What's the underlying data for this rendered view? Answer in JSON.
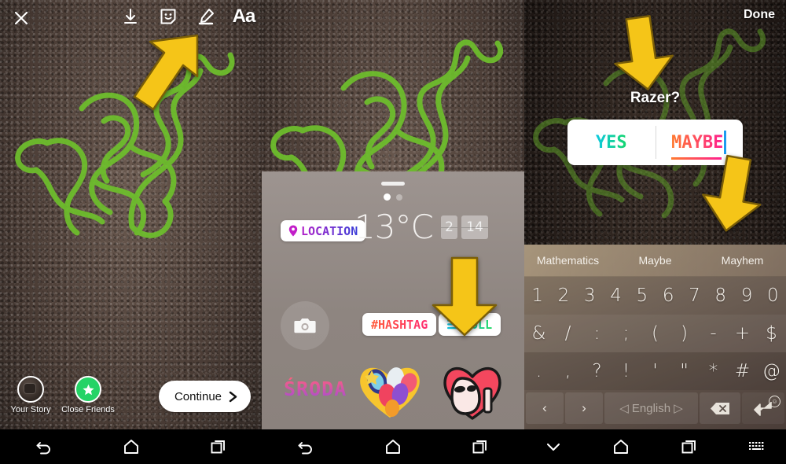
{
  "panel1": {
    "name": "instagram-story-editor",
    "toolbar": {
      "close_icon": "close-icon",
      "save_icon": "download-icon",
      "sticker_icon": "sticker-smiley-icon",
      "draw_icon": "marker-pen-icon",
      "text_label": "Aa"
    },
    "audience": [
      {
        "label": "Your Story",
        "icon": "avatar"
      },
      {
        "label": "Close Friends",
        "icon": "green-star-icon"
      }
    ],
    "continue_label": "Continue",
    "continue_chevron": "chevron-right-icon",
    "annotation": "arrow-pointing-to-sticker-icon",
    "nav": [
      "back-icon",
      "home-icon",
      "recents-icon"
    ]
  },
  "panel2": {
    "name": "sticker-tray",
    "handle": "drag-handle",
    "page_dots": {
      "count": 2,
      "active": 0
    },
    "stickers": [
      {
        "id": "location",
        "label": "LOCATION",
        "icon": "map-pin-icon"
      },
      {
        "id": "temperature",
        "label": "13°C"
      },
      {
        "id": "time",
        "digits": [
          "2",
          "14"
        ]
      },
      {
        "id": "camera",
        "label": "",
        "icon": "camera-icon"
      },
      {
        "id": "hashtag",
        "label": "#HASHTAG"
      },
      {
        "id": "poll",
        "label": "POLL",
        "icon": "poll-bars-icon"
      },
      {
        "id": "sroda",
        "label": "ŚRODA"
      },
      {
        "id": "heart-collage",
        "label": ""
      },
      {
        "id": "heart-face",
        "label": ""
      }
    ],
    "annotation": "arrow-pointing-to-poll-sticker",
    "nav": [
      "back-icon",
      "home-icon",
      "recents-icon"
    ]
  },
  "panel3": {
    "name": "poll-editing",
    "done_label": "Done",
    "poll": {
      "question": "Razer?",
      "options": [
        "YES",
        "MAYBE"
      ],
      "active_option_index": 1
    },
    "annotations": [
      "arrow-pointing-to-question",
      "arrow-pointing-to-maybe-option"
    ],
    "keyboard": {
      "suggestions": [
        "Mathematics",
        "Maybe",
        "Mayhem"
      ],
      "row1": [
        "1",
        "2",
        "3",
        "4",
        "5",
        "6",
        "7",
        "8",
        "9",
        "0"
      ],
      "row2": [
        "&",
        "/",
        ":",
        ";",
        "(",
        ")",
        "-",
        "+",
        "$"
      ],
      "row3": [
        ".",
        ",",
        "?",
        "!",
        "'",
        "\"",
        "*",
        "#",
        "@"
      ],
      "bottom": {
        "left_arrow": "‹",
        "right_arrow": "›",
        "space_label": "◁ English ▷",
        "backspace_icon": "backspace-icon",
        "enter_icon": "enter-icon",
        "emoji_badge": "☺"
      }
    },
    "nav": [
      "collapse-keyboard-icon",
      "home-icon",
      "recents-icon",
      "keyboard-indicator-icon"
    ]
  },
  "colors": {
    "arrow": "#F5C518",
    "close_friends": "#25D366",
    "poll_accent": "#1ed760",
    "caret": "#1d9bf0"
  }
}
